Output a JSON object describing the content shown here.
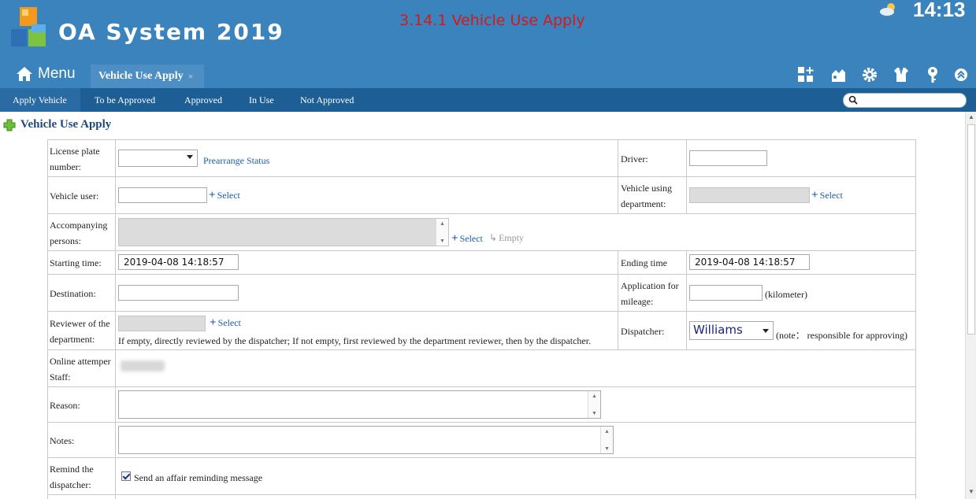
{
  "header": {
    "app_title": "OA System 2019",
    "page_caption": "3.14.1 Vehicle Use Apply",
    "clock": "14:13",
    "weather_icon": "partly-cloudy-icon",
    "menu_label": "Menu",
    "tab_label": "Vehicle Use Apply",
    "tab_close": "×"
  },
  "subnav": {
    "items": [
      "Apply Vehicle",
      "To be Approved",
      "Approved",
      "In Use",
      "Not Approved"
    ],
    "active_index": 0,
    "search_placeholder": ""
  },
  "form": {
    "title": "Vehicle Use Apply",
    "license_label_1": "License plate",
    "license_label_2": "number:",
    "prearrange_link": "Prearrange Status",
    "driver_label": "Driver:",
    "vehicle_user_label": "Vehicle user:",
    "select_link": "Select",
    "empty_link": "Empty",
    "dept_label_1": "Vehicle using",
    "dept_label_2": "department:",
    "accompany_label_1": "Accompanying",
    "accompany_label_2": "persons:",
    "start_label": "Starting time:",
    "start_value": "2019-04-08 14:18:57",
    "end_label": "Ending time",
    "end_value": "2019-04-08 14:18:57",
    "destination_label": "Destination:",
    "mileage_label_1": "Application for",
    "mileage_label_2": "mileage:",
    "mileage_unit": "(kilometer)",
    "reviewer_label_1": "Reviewer of the",
    "reviewer_label_2": "department:",
    "reviewer_hint": "If empty, directly reviewed by the dispatcher; If not empty, first reviewed by the department reviewer, then by the dispatcher.",
    "dispatcher_label": "Dispatcher:",
    "dispatcher_value": "Williams",
    "dispatcher_note": "(note： responsible for approving)",
    "online_label_1": "Online attemper",
    "online_label_2": "Staff:",
    "reason_label": "Reason:",
    "notes_label": "Notes:",
    "remind_label_1": "Remind the",
    "remind_label_2": "dispatcher:",
    "remind_checkbox_label": "Send an affair reminding message",
    "remind_checked": true
  },
  "colors": {
    "header_bg": "#3b83bc",
    "subnav_bg": "#1d5f94",
    "caption_red": "#d4191c",
    "link_blue": "#1a5da6"
  }
}
